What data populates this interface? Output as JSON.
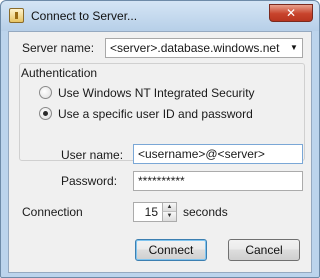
{
  "window": {
    "title": "Connect to Server...",
    "close_glyph": "✕",
    "icon": "app-icon"
  },
  "server": {
    "label": "Server name:",
    "value": "<server>.database.windows.net",
    "dropdown_icon": "chevron-down-icon"
  },
  "auth": {
    "legend": "Authentication",
    "options": [
      {
        "label": "Use Windows NT Integrated Security",
        "selected": false
      },
      {
        "label": "Use a specific user ID and password",
        "selected": true
      }
    ]
  },
  "credentials": {
    "username_label": "User name:",
    "username_value": "<username>@<server>",
    "password_label": "Password:",
    "password_value": "**********"
  },
  "connection": {
    "label": "Connection",
    "value": "15",
    "unit": "seconds"
  },
  "buttons": {
    "connect": "Connect",
    "cancel": "Cancel"
  },
  "colors": {
    "frame": "#bcd4ec",
    "close_button": "#c8432c",
    "default_button_border": "#3c7fb1"
  }
}
